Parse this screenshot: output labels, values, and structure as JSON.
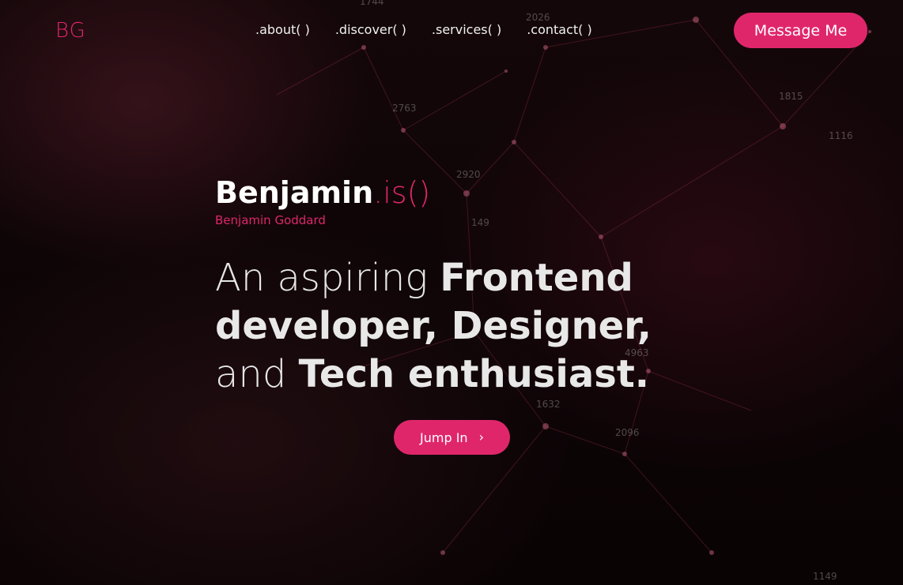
{
  "logo": "BG",
  "nav": [
    ".about( )",
    ".discover( )",
    ".services( )",
    ".contact( )"
  ],
  "header": {
    "cta_label": "Message Me"
  },
  "hero": {
    "name_bold": "Benjamin",
    "name_suffix": ".is()",
    "full_name": "Benjamin Goddard",
    "tagline": {
      "p1": "An aspiring ",
      "b1": "Frontend developer, Designer,",
      "p2": " and ",
      "b2": "Tech enthusiast."
    },
    "jump_label": "Jump In",
    "jump_icon": "chevron-right-icon"
  },
  "background_numbers": [
    "1744",
    "2026",
    "2763",
    "1815",
    "1116",
    "2920",
    "149",
    "4963",
    "1632",
    "2096",
    "1149"
  ],
  "colors": {
    "accent": "#e0266b",
    "background": "#0d0507",
    "text": "#e6e6e6"
  }
}
